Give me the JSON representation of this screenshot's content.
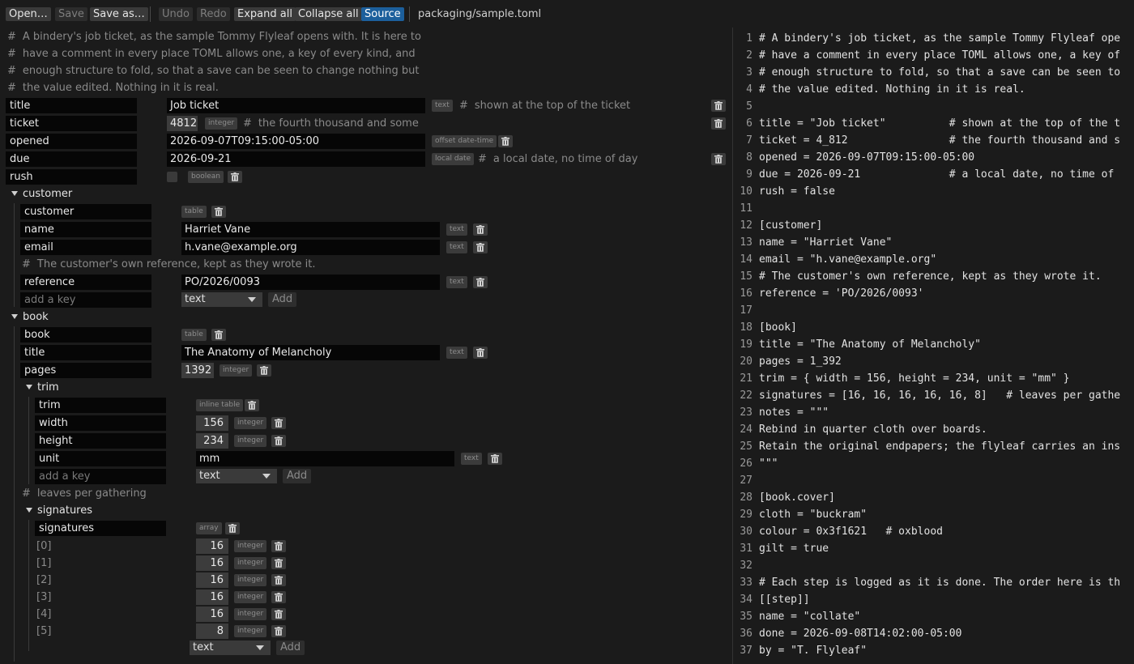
{
  "toolbar": {
    "open": "Open…",
    "save": "Save",
    "save_as": "Save as…",
    "undo": "Undo",
    "redo": "Redo",
    "expand_all": "Expand all",
    "collapse_all": "Collapse all",
    "source": "Source",
    "path": "packaging/sample.toml"
  },
  "tree": {
    "hash": "#",
    "header_comments": [
      "A bindery's job ticket, as the sample Tommy Flyleaf opens with. It is here to",
      "have a comment in every place TOML allows one, a key of every kind, and",
      "enough structure to fold, so that a save can be seen to change nothing but",
      "the value edited. Nothing in it is real."
    ],
    "title": {
      "key": "title",
      "value": "Job ticket",
      "type": "text",
      "comment": "shown at the top of the ticket"
    },
    "ticket": {
      "key": "ticket",
      "value": "4812",
      "type": "integer",
      "comment": "the fourth thousand and some"
    },
    "opened": {
      "key": "opened",
      "value": "2026-09-07T09:15:00-05:00",
      "type": "offset date-time"
    },
    "due": {
      "key": "due",
      "value": "2026-09-21",
      "type": "local date",
      "comment": "a local date, no time of day"
    },
    "rush": {
      "key": "rush",
      "checked": false,
      "type": "boolean"
    },
    "customer": {
      "section": "customer",
      "header_key": "customer",
      "header_type": "table",
      "name": {
        "key": "name",
        "value": "Harriet Vane",
        "type": "text"
      },
      "email": {
        "key": "email",
        "value": "h.vane@example.org",
        "type": "text"
      },
      "comment": "The customer's own reference, kept as they wrote it.",
      "reference": {
        "key": "reference",
        "value": "PO/2026/0093",
        "type": "text"
      },
      "add": {
        "placeholder": "add a key",
        "select": "text",
        "button": "Add"
      }
    },
    "book": {
      "section": "book",
      "header_key": "book",
      "header_type": "table",
      "title": {
        "key": "title",
        "value": "The Anatomy of Melancholy",
        "type": "text"
      },
      "pages": {
        "key": "pages",
        "value": "1392",
        "type": "integer"
      },
      "trim": {
        "section": "trim",
        "header_key": "trim",
        "header_type": "inline table",
        "width": {
          "key": "width",
          "value": "156",
          "type": "integer"
        },
        "height": {
          "key": "height",
          "value": "234",
          "type": "integer"
        },
        "unit": {
          "key": "unit",
          "value": "mm",
          "type": "text"
        },
        "add": {
          "placeholder": "add a key",
          "select": "text",
          "button": "Add"
        }
      },
      "signatures_comment": "leaves per gathering",
      "signatures": {
        "section": "signatures",
        "header_key": "signatures",
        "header_type": "array",
        "items": [
          {
            "index": "[0]",
            "value": "16",
            "type": "integer"
          },
          {
            "index": "[1]",
            "value": "16",
            "type": "integer"
          },
          {
            "index": "[2]",
            "value": "16",
            "type": "integer"
          },
          {
            "index": "[3]",
            "value": "16",
            "type": "integer"
          },
          {
            "index": "[4]",
            "value": "16",
            "type": "integer"
          },
          {
            "index": "[5]",
            "value": "8",
            "type": "integer"
          }
        ],
        "add": {
          "select": "text",
          "button": "Add"
        }
      }
    }
  },
  "source_lines": [
    {
      "n": "1",
      "text": "# A bindery's job ticket, as the sample Tommy Flyleaf ope"
    },
    {
      "n": "2",
      "text": "# have a comment in every place TOML allows one, a key of"
    },
    {
      "n": "3",
      "text": "# enough structure to fold, so that a save can be seen to"
    },
    {
      "n": "4",
      "text": "# the value edited. Nothing in it is real."
    },
    {
      "n": "5",
      "text": ""
    },
    {
      "n": "6",
      "text": "title = \"Job ticket\"          # shown at the top of the t"
    },
    {
      "n": "7",
      "text": "ticket = 4_812                # the fourth thousand and s"
    },
    {
      "n": "8",
      "text": "opened = 2026-09-07T09:15:00-05:00"
    },
    {
      "n": "9",
      "text": "due = 2026-09-21              # a local date, no time of"
    },
    {
      "n": "10",
      "text": "rush = false"
    },
    {
      "n": "11",
      "text": ""
    },
    {
      "n": "12",
      "text": "[customer]"
    },
    {
      "n": "13",
      "text": "name = \"Harriet Vane\""
    },
    {
      "n": "14",
      "text": "email = \"h.vane@example.org\""
    },
    {
      "n": "15",
      "text": "# The customer's own reference, kept as they wrote it."
    },
    {
      "n": "16",
      "text": "reference = 'PO/2026/0093'"
    },
    {
      "n": "17",
      "text": ""
    },
    {
      "n": "18",
      "text": "[book]"
    },
    {
      "n": "19",
      "text": "title = \"The Anatomy of Melancholy\""
    },
    {
      "n": "20",
      "text": "pages = 1_392"
    },
    {
      "n": "21",
      "text": "trim = { width = 156, height = 234, unit = \"mm\" }"
    },
    {
      "n": "22",
      "text": "signatures = [16, 16, 16, 16, 16, 8]   # leaves per gathe"
    },
    {
      "n": "23",
      "text": "notes = \"\"\""
    },
    {
      "n": "24",
      "text": "Rebind in quarter cloth over boards."
    },
    {
      "n": "25",
      "text": "Retain the original endpapers; the flyleaf carries an ins"
    },
    {
      "n": "26",
      "text": "\"\"\""
    },
    {
      "n": "27",
      "text": ""
    },
    {
      "n": "28",
      "text": "[book.cover]"
    },
    {
      "n": "29",
      "text": "cloth = \"buckram\""
    },
    {
      "n": "30",
      "text": "colour = 0x3f1621   # oxblood"
    },
    {
      "n": "31",
      "text": "gilt = true"
    },
    {
      "n": "32",
      "text": ""
    },
    {
      "n": "33",
      "text": "# Each step is logged as it is done. The order here is th"
    },
    {
      "n": "34",
      "text": "[[step]]"
    },
    {
      "n": "35",
      "text": "name = \"collate\""
    },
    {
      "n": "36",
      "text": "done = 2026-09-08T14:02:00-05:00"
    },
    {
      "n": "37",
      "text": "by = \"T. Flyleaf\""
    }
  ]
}
